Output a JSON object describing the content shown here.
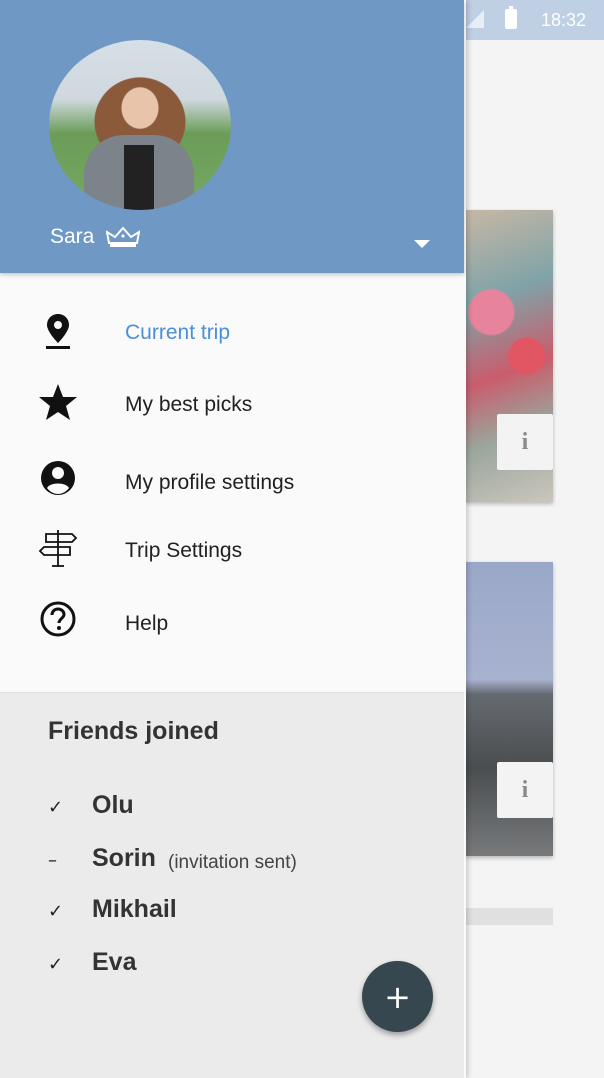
{
  "status_bar": {
    "time": "18:32"
  },
  "drawer": {
    "user": {
      "name": "Sara"
    },
    "menu": [
      {
        "label": "Current trip",
        "icon": "location-pin-icon",
        "active": true
      },
      {
        "label": "My best picks",
        "icon": "star-icon"
      },
      {
        "label": "My profile settings",
        "icon": "account-circle-icon"
      },
      {
        "label": "Trip Settings",
        "icon": "signpost-icon"
      },
      {
        "label": "Help",
        "icon": "help-circle-icon"
      }
    ],
    "friends": {
      "title": "Friends joined",
      "list": [
        {
          "mark": "✓",
          "name": "Olu",
          "note": ""
        },
        {
          "mark": "–",
          "name": "Sorin",
          "note": "(invitation sent)"
        },
        {
          "mark": "✓",
          "name": "Mikhail",
          "note": ""
        },
        {
          "mark": "✓",
          "name": "Eva",
          "note": ""
        }
      ]
    },
    "fab": {
      "label": "+"
    }
  },
  "background": {
    "cards": [
      {
        "info_label": "i"
      },
      {
        "info_label": "i"
      }
    ]
  },
  "colors": {
    "header": "#6f98c4",
    "active_menu": "#4a90d9",
    "fab": "#37474f",
    "friends_panel": "#ebebeb"
  }
}
